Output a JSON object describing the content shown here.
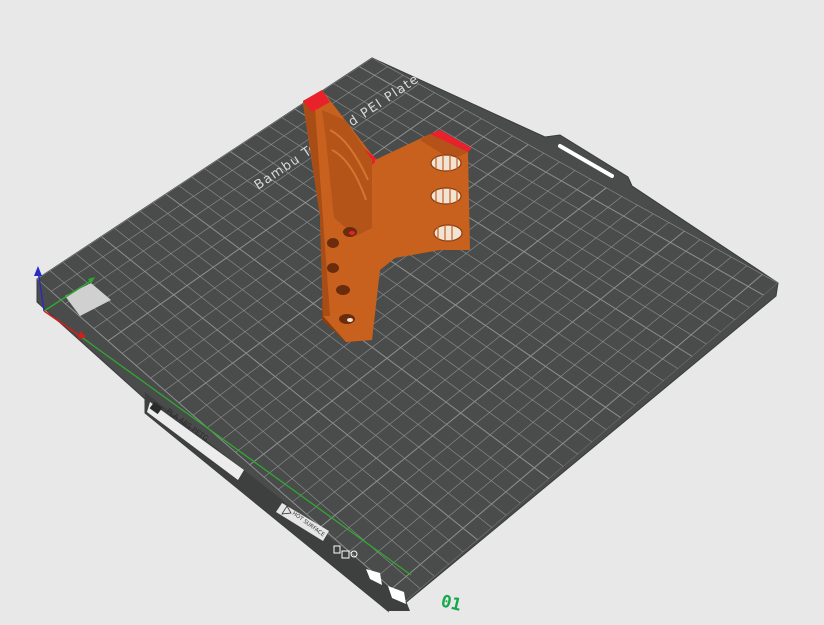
{
  "viewport": {
    "background": "#e8e8e8",
    "plate_color": "#4a4c4c",
    "grid_color": "#8e9090",
    "model_color": "#c8601e",
    "model_overhang_color": "#e8212a"
  },
  "plate": {
    "brand_label": "Bambu Textured PEI Plate",
    "sticker_label": "PLA ABS PETG",
    "hot_surface_label": "HOT SURFACE",
    "plate_number": "01",
    "plate_number_color": "#18a84c"
  },
  "axes": {
    "x_color": "#d81b1b",
    "y_color": "#2fa82f",
    "z_color": "#2a2ac8"
  },
  "icons": {
    "lock": "lock-icon",
    "orient": "orient-icon",
    "settings": "settings-icon"
  }
}
